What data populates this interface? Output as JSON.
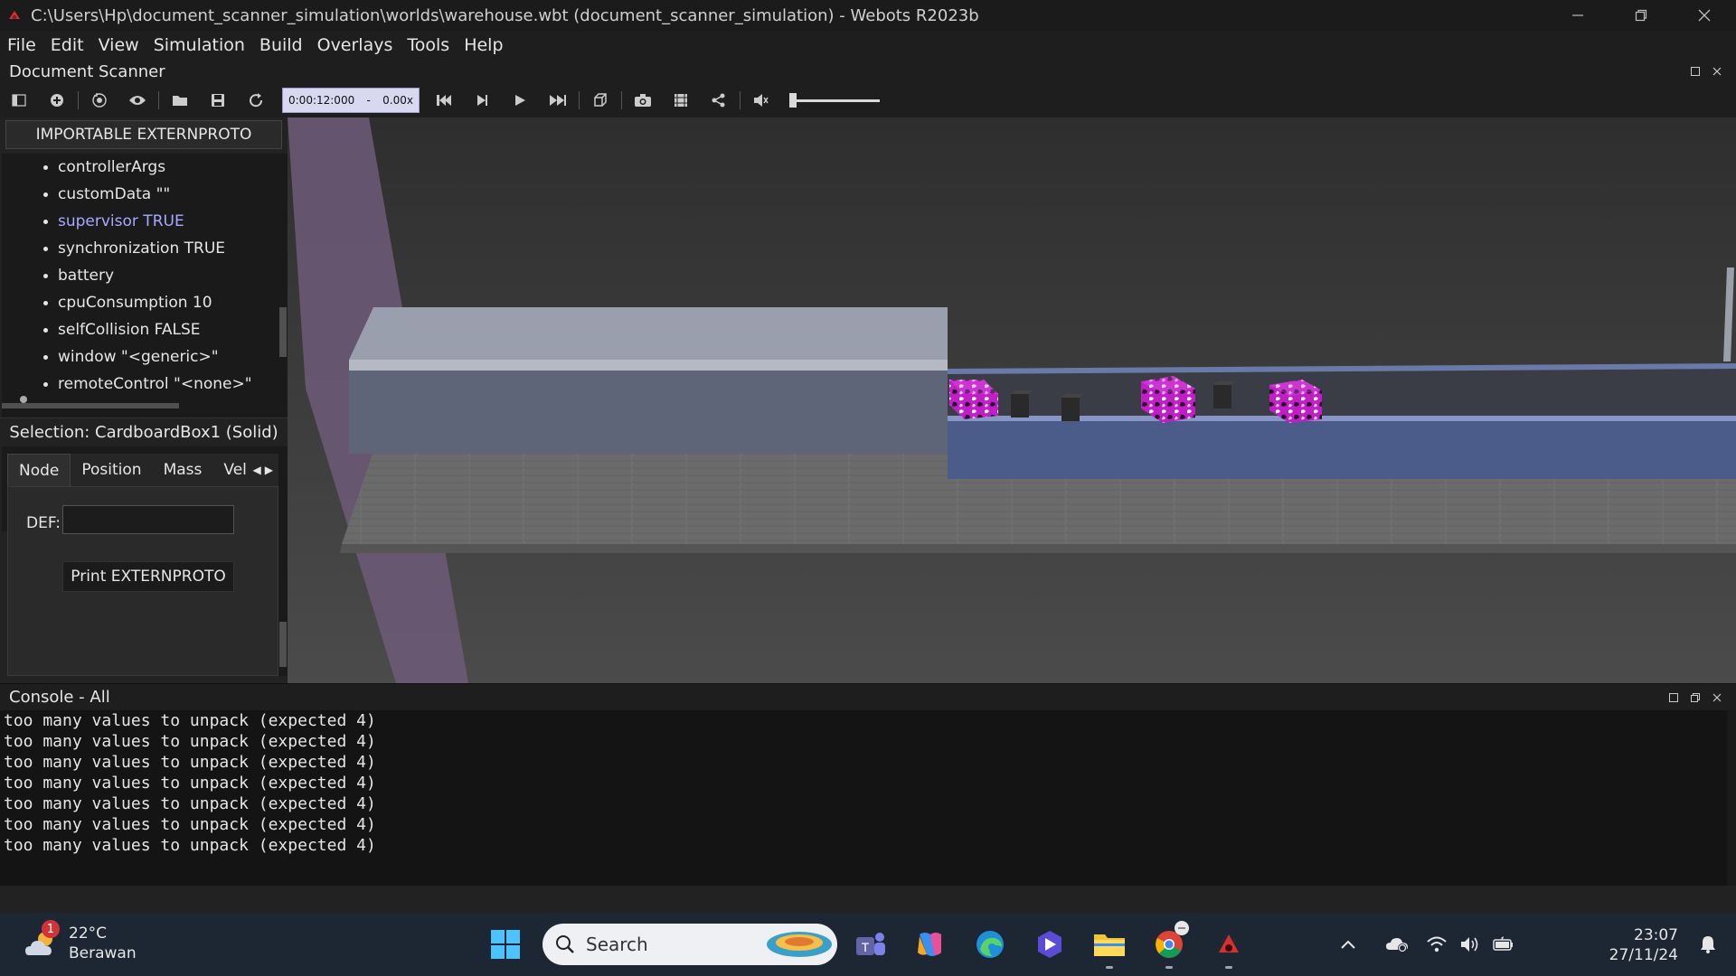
{
  "window": {
    "title": "C:\\Users\\Hp\\document_scanner_simulation\\worlds\\warehouse.wbt (document_scanner_simulation) - Webots R2023b"
  },
  "menu": {
    "items": [
      "File",
      "Edit",
      "View",
      "Simulation",
      "Build",
      "Overlays",
      "Tools",
      "Help"
    ]
  },
  "dock": {
    "title": "Document Scanner"
  },
  "toolbar": {
    "time": "0:00:12:000",
    "dash": "-",
    "speed": "0.00x",
    "volume_level": 0.0
  },
  "scene_tree": {
    "import_button": "IMPORTABLE EXTERNPROTO",
    "fields": [
      {
        "label": "controllerArgs",
        "highlighted": false
      },
      {
        "label": "customData \"\"",
        "highlighted": false
      },
      {
        "label": "supervisor TRUE",
        "highlighted": true
      },
      {
        "label": "synchronization TRUE",
        "highlighted": false
      },
      {
        "label": "battery",
        "highlighted": false
      },
      {
        "label": "cpuConsumption 10",
        "highlighted": false
      },
      {
        "label": "selfCollision FALSE",
        "highlighted": false
      },
      {
        "label": "window \"<generic>\"",
        "highlighted": false
      },
      {
        "label": "remoteControl \"<none>\"",
        "highlighted": false
      }
    ]
  },
  "selection": {
    "label": "Selection: CardboardBox1 (Solid)",
    "tabs": [
      "Node",
      "Position",
      "Mass",
      "Vel"
    ],
    "active_tab": "Node",
    "def_label": "DEF:",
    "def_value": "",
    "print_button": "Print EXTERNPROTO"
  },
  "console": {
    "title": "Console - All",
    "lines": [
      "too many values to unpack (expected 4)",
      "too many values to unpack (expected 4)",
      "too many values to unpack (expected 4)",
      "too many values to unpack (expected 4)",
      "too many values to unpack (expected 4)",
      "too many values to unpack (expected 4)",
      "too many values to unpack (expected 4)"
    ]
  },
  "taskbar": {
    "weather_temp": "22°C",
    "weather_desc": "Berawan",
    "weather_badge": "1",
    "search_label": "Search",
    "time": "23:07",
    "date": "27/11/24"
  },
  "colors": {
    "accent_text": "#a8a8ff",
    "box_magenta": "#c020c0",
    "conveyor_blue": "#4a5a8a"
  }
}
